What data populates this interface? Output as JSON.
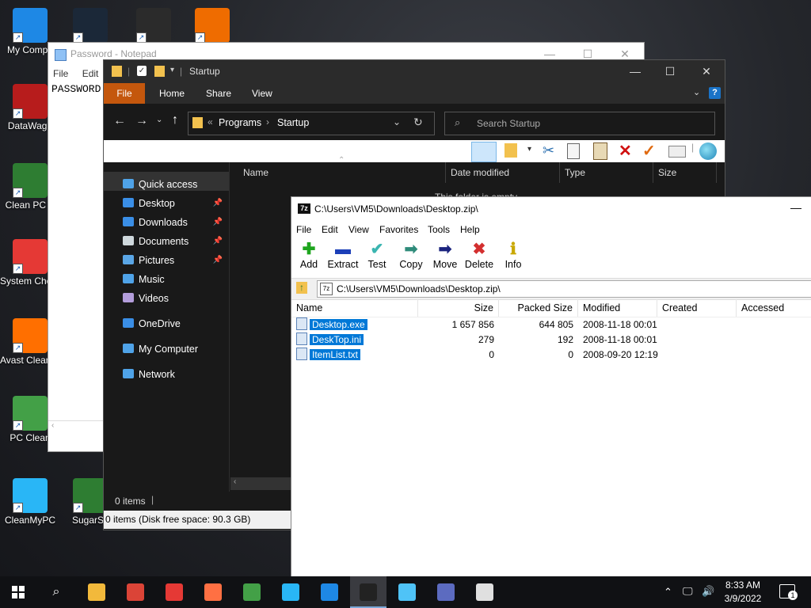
{
  "desktop": {
    "icons": [
      {
        "label": "My Compu",
        "icon": "monitor-icon",
        "color": "#1e88e5"
      },
      {
        "label": "",
        "icon": "steam-icon",
        "color": "#1b2838"
      },
      {
        "label": "",
        "icon": "player-icon",
        "color": "#2b2b2b"
      },
      {
        "label": "",
        "icon": "pdf-icon",
        "color": "#ef6c00"
      },
      {
        "label": "DataWago",
        "icon": "datawagon-icon",
        "color": "#b71c1c"
      },
      {
        "label": "Clean PC P",
        "icon": "cleanpc-icon",
        "color": "#2e7d32"
      },
      {
        "label": "System Checkup",
        "icon": "system-checkup-icon",
        "color": "#e53935"
      },
      {
        "label": "Avast Cleanu...",
        "icon": "avast-icon",
        "color": "#ff6f00"
      },
      {
        "label": "PC Clean",
        "icon": "pc-clean-icon",
        "color": "#43a047"
      },
      {
        "label": "CleanMyPC",
        "icon": "cleanmypc-icon",
        "color": "#29b6f6"
      },
      {
        "label": "SugarSy",
        "icon": "sugarsync-icon",
        "color": "#2e7d32"
      }
    ]
  },
  "notepad": {
    "title": "Password - Notepad",
    "menu": [
      "File",
      "Edit"
    ],
    "content": "PASSWORD"
  },
  "explorer": {
    "title": "Startup",
    "ribbon_tabs": [
      "File",
      "Home",
      "Share",
      "View"
    ],
    "breadcrumb": [
      "Programs",
      "Startup"
    ],
    "search_placeholder": "Search Startup",
    "nav": [
      {
        "label": "Quick access",
        "icon": "star-icon",
        "pinned": false
      },
      {
        "label": "Desktop",
        "icon": "desktop-folder-icon",
        "pinned": true
      },
      {
        "label": "Downloads",
        "icon": "downloads-icon",
        "pinned": true
      },
      {
        "label": "Documents",
        "icon": "documents-icon",
        "pinned": true
      },
      {
        "label": "Pictures",
        "icon": "pictures-icon",
        "pinned": true
      },
      {
        "label": "Music",
        "icon": "music-icon",
        "pinned": false
      },
      {
        "label": "Videos",
        "icon": "videos-icon",
        "pinned": false
      },
      {
        "label": "OneDrive",
        "icon": "cloud-icon",
        "pinned": false
      },
      {
        "label": "My Computer",
        "icon": "computer-icon",
        "pinned": false
      },
      {
        "label": "Network",
        "icon": "network-icon",
        "pinned": false
      }
    ],
    "columns": [
      "Name",
      "Date modified",
      "Type",
      "Size"
    ],
    "empty_text": "This folder is empty.",
    "status": "0 items",
    "status_bar2": "0 items (Disk free space: 90.3 GB)"
  },
  "sevenzip": {
    "title": "C:\\Users\\VM5\\Downloads\\Desktop.zip\\",
    "menu": [
      "File",
      "Edit",
      "View",
      "Favorites",
      "Tools",
      "Help"
    ],
    "tools": [
      {
        "label": "Add",
        "glyph": "✚",
        "color": "#1ea51e"
      },
      {
        "label": "Extract",
        "glyph": "▬",
        "color": "#1c3fb8"
      },
      {
        "label": "Test",
        "glyph": "✔",
        "color": "#3ab5b0"
      },
      {
        "label": "Copy",
        "glyph": "➡",
        "color": "#2e8b7a"
      },
      {
        "label": "Move",
        "glyph": "➡",
        "color": "#1a237e"
      },
      {
        "label": "Delete",
        "glyph": "✖",
        "color": "#d32f2f"
      },
      {
        "label": "Info",
        "glyph": "ℹ",
        "color": "#c9a800"
      }
    ],
    "path": "C:\\Users\\VM5\\Downloads\\Desktop.zip\\",
    "columns": [
      "Name",
      "Size",
      "Packed Size",
      "Modified",
      "Created",
      "Accessed"
    ],
    "files": [
      {
        "name": "Desktop.exe",
        "size": "1 657 856",
        "packed": "644 805",
        "modified": "2008-11-18 00:01"
      },
      {
        "name": "DeskTop.ini",
        "size": "279",
        "packed": "192",
        "modified": "2008-11-18 00:01"
      },
      {
        "name": "ItemList.txt",
        "size": "0",
        "packed": "0",
        "modified": "2008-09-20 12:19"
      }
    ]
  },
  "taskbar": {
    "time": "8:33 AM",
    "date": "3/9/2022",
    "notification_count": "1",
    "apps": [
      {
        "icon": "file-explorer-icon",
        "color": "#f2b93b"
      },
      {
        "icon": "chrome-icon",
        "color": "#db4437"
      },
      {
        "icon": "power-app-icon",
        "color": "#e53935"
      },
      {
        "icon": "rocket-app-icon",
        "color": "#ff7043"
      },
      {
        "icon": "recycle-app-icon",
        "color": "#43a047"
      },
      {
        "icon": "monitor-app-icon",
        "color": "#29b6f6"
      },
      {
        "icon": "sail-app-icon",
        "color": "#1e88e5"
      },
      {
        "icon": "sevenzip-app-icon",
        "color": "#222222"
      },
      {
        "icon": "card-app-icon",
        "color": "#4fc3f7"
      },
      {
        "icon": "network-app-icon",
        "color": "#5c6bc0"
      },
      {
        "icon": "shield-app-icon",
        "color": "#e0e0e0"
      }
    ]
  }
}
